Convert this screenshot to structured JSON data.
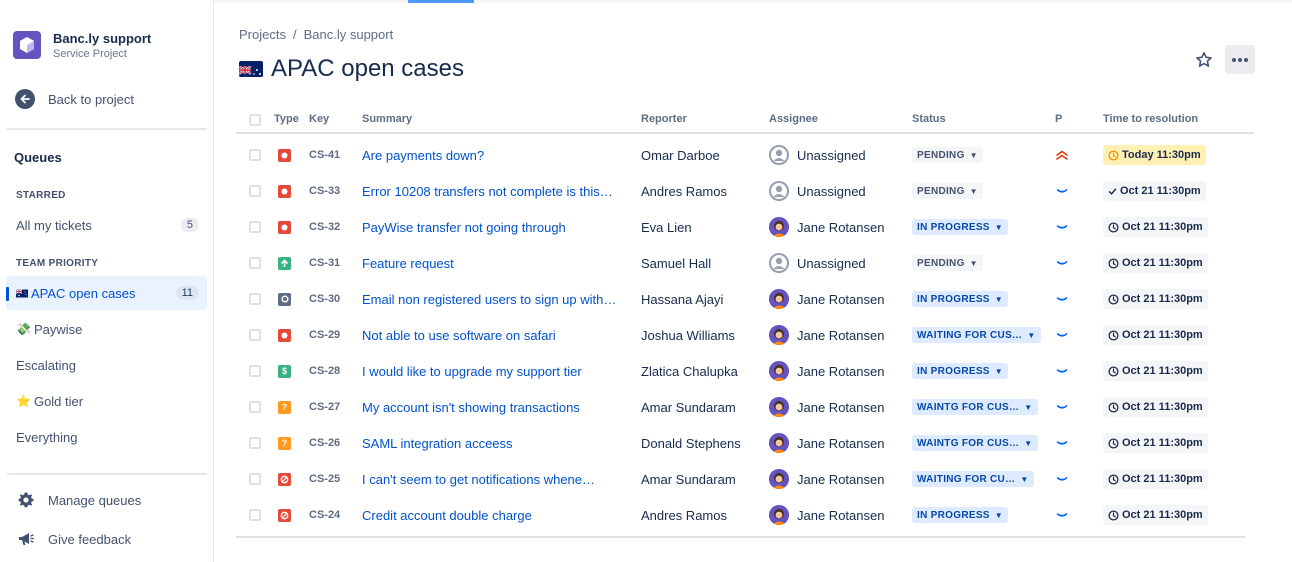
{
  "sidebar": {
    "project_name": "Banc.ly support",
    "project_type": "Service Project",
    "back_label": "Back to project",
    "queues_heading": "Queues",
    "starred_heading": "STARRED",
    "team_priority_heading": "TEAM PRIORITY",
    "items": [
      {
        "label": "All my tickets",
        "count": "5",
        "emoji": ""
      },
      {
        "label": "APAC open cases",
        "count": "11",
        "emoji": "flag",
        "active": true
      },
      {
        "label": "Paywise",
        "count": "",
        "emoji": "💸"
      },
      {
        "label": "Escalating",
        "count": "",
        "emoji": ""
      },
      {
        "label": "Gold tier",
        "count": "",
        "emoji": "⭐"
      },
      {
        "label": "Everything",
        "count": "",
        "emoji": ""
      }
    ],
    "manage_label": "Manage queues",
    "feedback_label": "Give feedback"
  },
  "breadcrumb": {
    "root": "Projects",
    "separator": "/",
    "current": "Banc.ly support"
  },
  "page": {
    "title": "APAC open cases"
  },
  "table": {
    "headers": {
      "type": "Type",
      "key": "Key",
      "summary": "Summary",
      "reporter": "Reporter",
      "assignee": "Assignee",
      "status": "Status",
      "priority": "P",
      "ttr": "Time to resolution"
    },
    "rows": [
      {
        "type": "bug",
        "key": "CS-41",
        "summary": "Are payments down?",
        "reporter": "Omar Darboe",
        "assignee": "Unassigned",
        "status": "PENDING",
        "status_style": "pending",
        "priority": "highest",
        "ttr": "Today 11:30pm",
        "ttr_style": "today",
        "ttr_icon": "clock"
      },
      {
        "type": "bug",
        "key": "CS-33",
        "summary": "Error 10208 transfers not complete is this…",
        "reporter": "Andres Ramos",
        "assignee": "Unassigned",
        "status": "PENDING",
        "status_style": "pending",
        "priority": "low",
        "ttr": "Oct 21 11:30pm",
        "ttr_style": "normal",
        "ttr_icon": "check"
      },
      {
        "type": "bug",
        "key": "CS-32",
        "summary": "PayWise transfer not going through",
        "reporter": "Eva Lien",
        "assignee": "Jane Rotansen",
        "status": "IN PROGRESS",
        "status_style": "blue",
        "priority": "low",
        "ttr": "Oct 21 11:30pm",
        "ttr_style": "normal",
        "ttr_icon": "clock"
      },
      {
        "type": "feature",
        "key": "CS-31",
        "summary": "Feature request",
        "reporter": "Samuel Hall",
        "assignee": "Unassigned",
        "status": "PENDING",
        "status_style": "pending",
        "priority": "low",
        "ttr": "Oct 21 11:30pm",
        "ttr_style": "normal",
        "ttr_icon": "clock"
      },
      {
        "type": "general",
        "key": "CS-30",
        "summary": "Email non registered users to sign up with…",
        "reporter": "Hassana Ajayi",
        "assignee": "Jane Rotansen",
        "status": "IN PROGRESS",
        "status_style": "blue",
        "priority": "low",
        "ttr": "Oct 21 11:30pm",
        "ttr_style": "normal",
        "ttr_icon": "clock"
      },
      {
        "type": "bug",
        "key": "CS-29",
        "summary": "Not able to use software on safari",
        "reporter": "Joshua Williams",
        "assignee": "Jane Rotansen",
        "status": "WAITING FOR CUS…",
        "status_style": "blue",
        "priority": "low",
        "ttr": "Oct 21 11:30pm",
        "ttr_style": "normal",
        "ttr_icon": "clock"
      },
      {
        "type": "billing",
        "key": "CS-28",
        "summary": "I would like to upgrade my support tier",
        "reporter": "Zlatica Chalupka",
        "assignee": "Jane Rotansen",
        "status": "IN PROGRESS",
        "status_style": "blue",
        "priority": "low",
        "ttr": "Oct 21 11:30pm",
        "ttr_style": "normal",
        "ttr_icon": "clock"
      },
      {
        "type": "question",
        "key": "CS-27",
        "summary": "My account isn't showing transactions",
        "reporter": "Amar Sundaram",
        "assignee": "Jane Rotansen",
        "status": "WAINTG FOR CUS…",
        "status_style": "blue",
        "priority": "low",
        "ttr": "Oct 21 11:30pm",
        "ttr_style": "normal",
        "ttr_icon": "clock"
      },
      {
        "type": "question",
        "key": "CS-26",
        "summary": "SAML integration acceess",
        "reporter": "Donald Stephens",
        "assignee": "Jane Rotansen",
        "status": "WAINTG FOR CUS…",
        "status_style": "blue",
        "priority": "low",
        "ttr": "Oct 21 11:30pm",
        "ttr_style": "normal",
        "ttr_icon": "clock"
      },
      {
        "type": "blocked",
        "key": "CS-25",
        "summary": "I can't seem to get notifications whene…",
        "reporter": "Amar Sundaram",
        "assignee": "Jane Rotansen",
        "status": "WAITING FOR CU…",
        "status_style": "blue",
        "priority": "low",
        "ttr": "Oct 21 11:30pm",
        "ttr_style": "normal",
        "ttr_icon": "clock"
      },
      {
        "type": "blocked",
        "key": "CS-24",
        "summary": "Credit account double charge",
        "reporter": "Andres Ramos",
        "assignee": "Jane Rotansen",
        "status": "IN PROGRESS",
        "status_style": "blue",
        "priority": "low",
        "ttr": "Oct 21 11:30pm",
        "ttr_style": "normal",
        "ttr_icon": "clock"
      }
    ]
  },
  "colors": {
    "brand": "#6554C0",
    "link": "#0052CC",
    "bug": "#E5493A",
    "feature": "#36B37E",
    "question": "#FF991F",
    "general": "#5E6C84"
  }
}
